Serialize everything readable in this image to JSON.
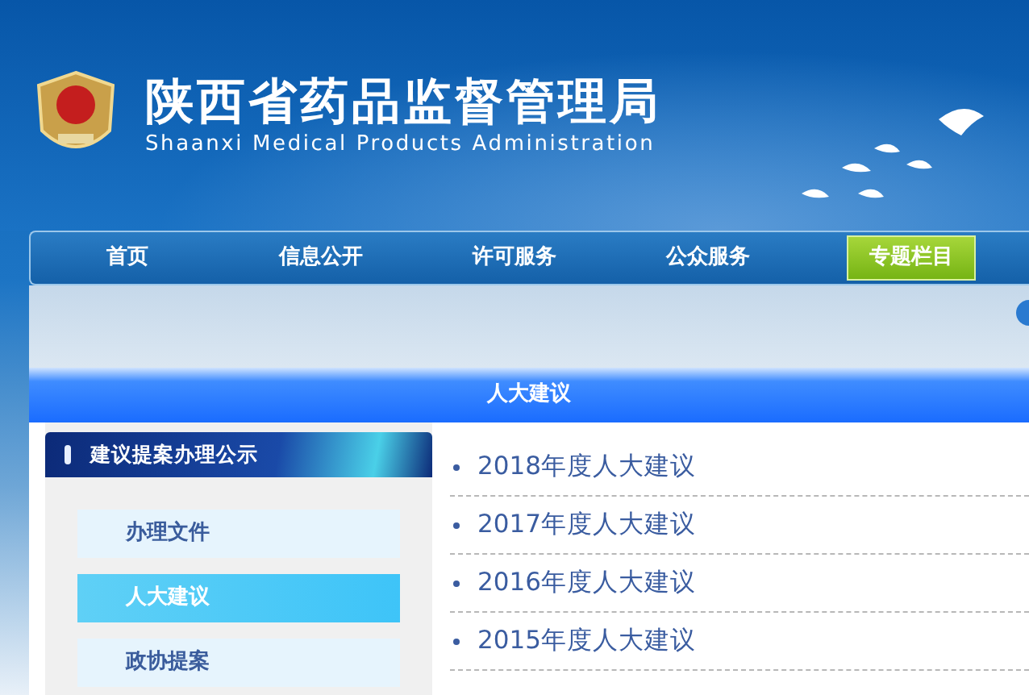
{
  "header": {
    "title": "陕西省药品监督管理局",
    "subtitle": "Shaanxi Medical Products Administration"
  },
  "nav": [
    {
      "label": "首页",
      "selected": false
    },
    {
      "label": "信息公开",
      "selected": false
    },
    {
      "label": "许可服务",
      "selected": false
    },
    {
      "label": "公众服务",
      "selected": false
    },
    {
      "label": "专题栏目",
      "selected": true
    }
  ],
  "section_title": "人大建议",
  "sidebar": {
    "heading": "建议提案办理公示",
    "items": [
      {
        "label": "办理文件",
        "selected": false
      },
      {
        "label": "人大建议",
        "selected": true
      },
      {
        "label": "政协提案",
        "selected": false
      }
    ]
  },
  "articles": [
    {
      "title": "2018年度人大建议"
    },
    {
      "title": "2017年度人大建议"
    },
    {
      "title": "2016年度人大建议"
    },
    {
      "title": "2015年度人大建议"
    }
  ]
}
